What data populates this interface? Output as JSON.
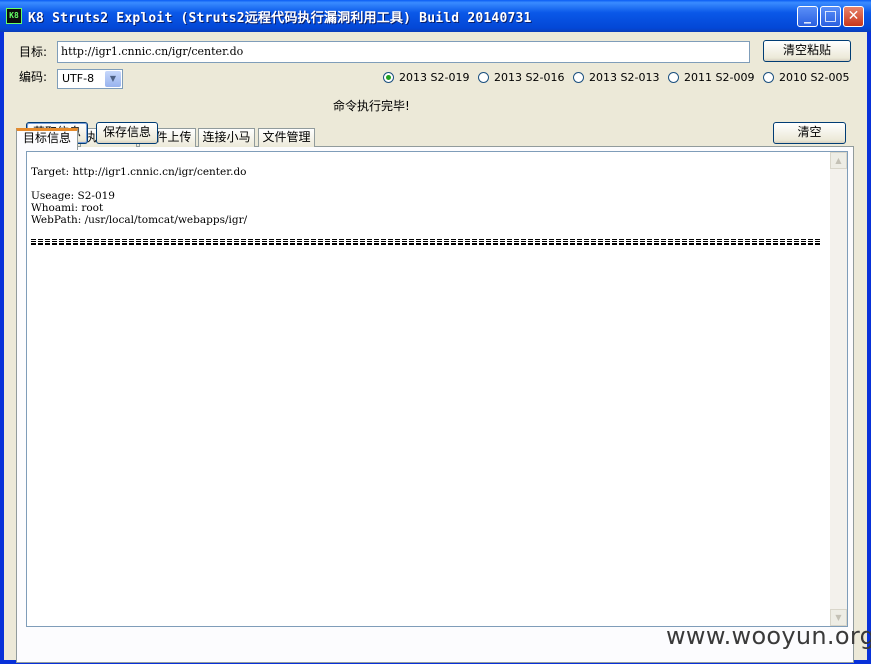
{
  "window": {
    "icon_text": "K8",
    "title": "K8 Struts2 Exploit (Struts2远程代码执行漏洞利用工具)  Build 20140731",
    "minimize_glyph": "_",
    "maximize_glyph": "□",
    "close_glyph": "✕"
  },
  "target": {
    "label": "目标:",
    "value": "http://igr1.cnnic.cn/igr/center.do",
    "clear_paste_button": "清空粘贴"
  },
  "encoding": {
    "label": "编码:",
    "selected": "UTF-8"
  },
  "exploits": [
    {
      "label": "2013 S2-019",
      "checked": true
    },
    {
      "label": "2013 S2-016",
      "checked": false
    },
    {
      "label": "2013 S2-013",
      "checked": false
    },
    {
      "label": "2011 S2-009",
      "checked": false
    },
    {
      "label": "2010 S2-005",
      "checked": false
    }
  ],
  "tabs": [
    {
      "label": "目标信息",
      "active": true
    },
    {
      "label": "执行命令",
      "active": false
    },
    {
      "label": "文件上传",
      "active": false
    },
    {
      "label": "连接小马",
      "active": false
    },
    {
      "label": "文件管理",
      "active": false
    }
  ],
  "status": "命令执行完毕!",
  "panel": {
    "get_info_button": "获取信息",
    "save_info_button": "保存信息",
    "clear_button": "清空"
  },
  "output": {
    "lines": "Target: http://igr1.cnnic.cn/igr/center.do\n\nUseage: S2-019\nWhoami: root\nWebPath: /usr/local/tomcat/webapps/igr/"
  },
  "watermark": "www.wooyun.org",
  "colors": {
    "titlebar": "#0a58e8",
    "face": "#ece9d8",
    "active_tab_accent": "#e68b2c",
    "radio_dot": "#21a121"
  }
}
